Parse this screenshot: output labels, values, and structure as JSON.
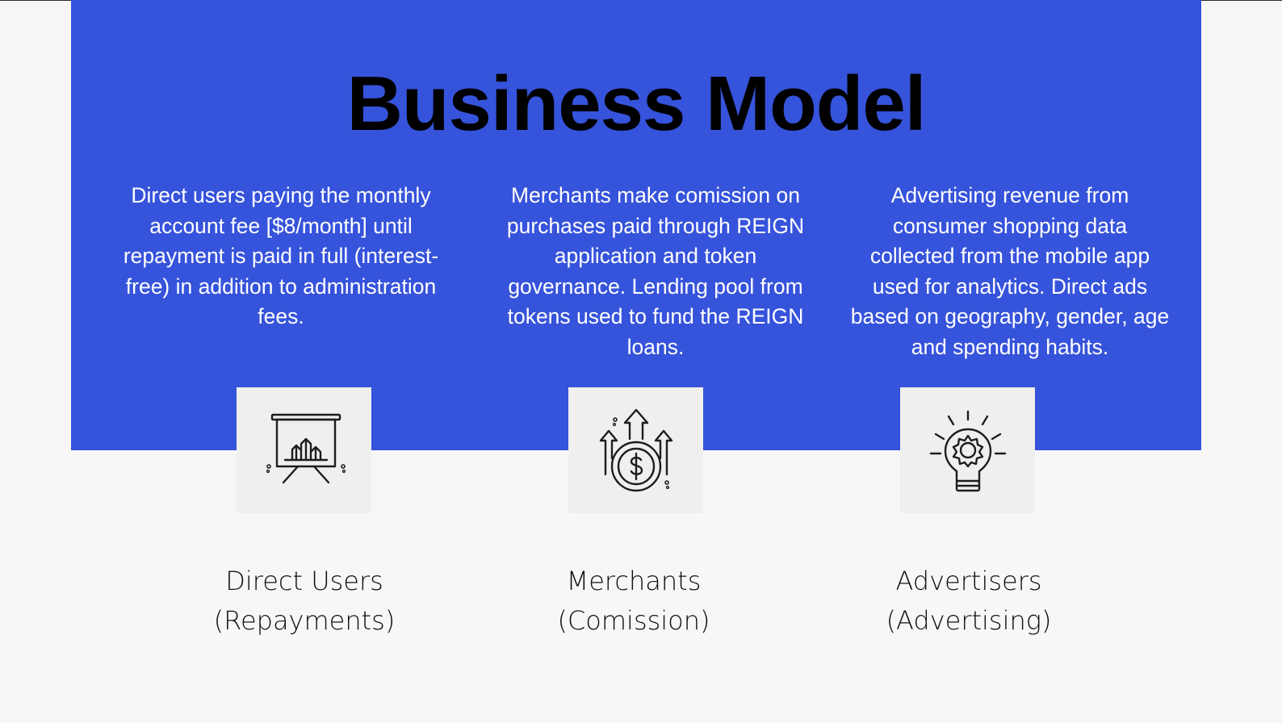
{
  "title": "Business Model",
  "columns": [
    {
      "description": "Direct users paying the monthly account fee [$8/month] until repayment is paid in full (interest-free) in addition to administration fees.",
      "icon": "presentation-chart-icon",
      "label_line1": "Direct Users",
      "label_line2": "(Repayments)"
    },
    {
      "description": "Merchants make comission on purchases paid through REIGN application and token governance. Lending pool from tokens used to fund the REIGN loans.",
      "icon": "dollar-coin-growth-icon",
      "label_line1": "Merchants",
      "label_line2": "(Comission)"
    },
    {
      "description": "Advertising revenue from consumer shopping data collected from the mobile app used for analytics. Direct ads based on geography, gender, age and spending habits.",
      "icon": "lightbulb-gear-icon",
      "label_line1": "Advertisers",
      "label_line2": "(Advertising)"
    }
  ],
  "colors": {
    "panel": "#3653db",
    "background": "#f7f7f7",
    "icon_box": "#efefed"
  }
}
